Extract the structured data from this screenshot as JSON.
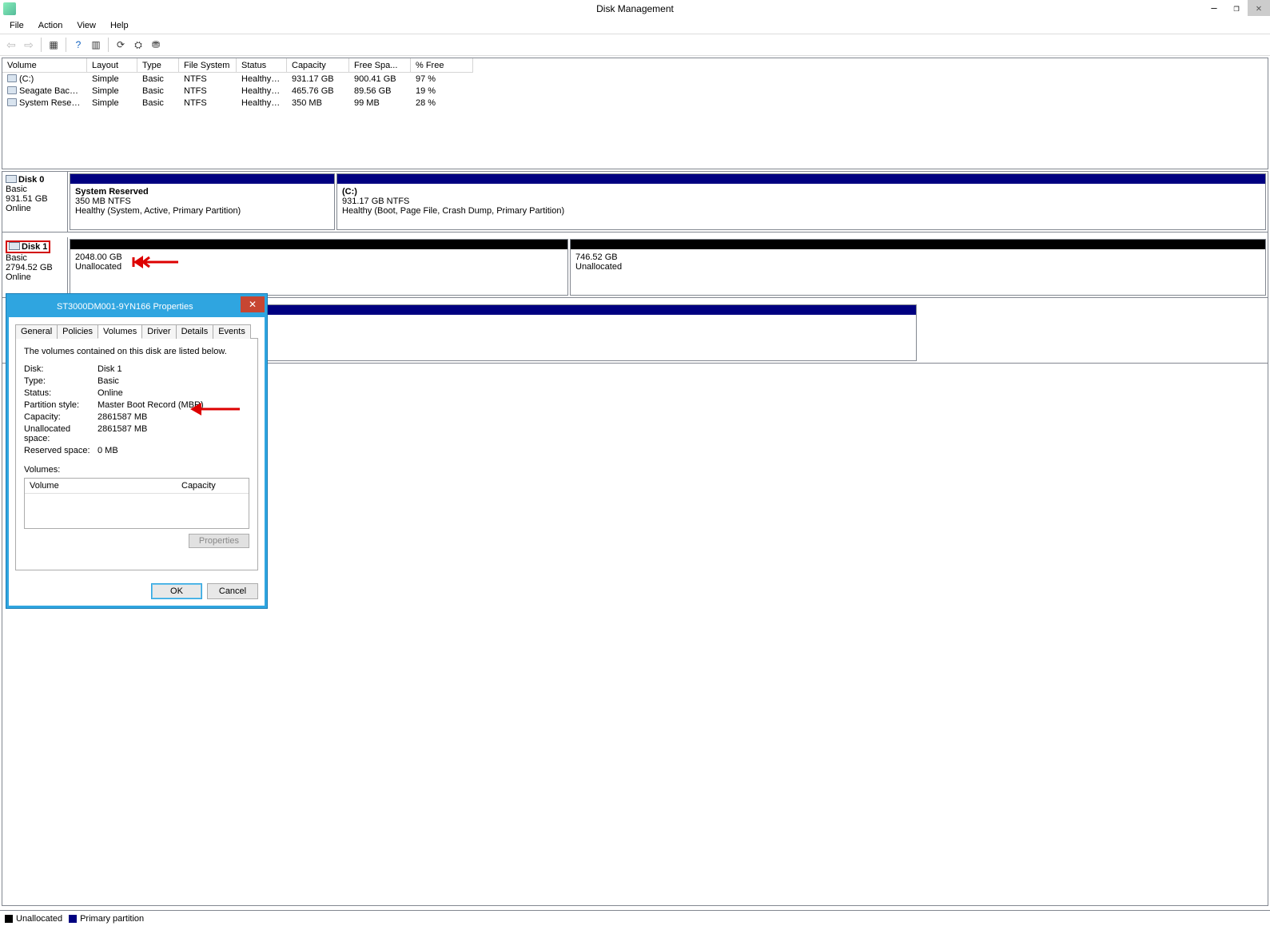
{
  "window": {
    "title": "Disk Management"
  },
  "menus": [
    "File",
    "Action",
    "View",
    "Help"
  ],
  "volume_table": {
    "headers": [
      "Volume",
      "Layout",
      "Type",
      "File System",
      "Status",
      "Capacity",
      "Free Spa...",
      "% Free"
    ],
    "rows": [
      {
        "volume": "(C:)",
        "layout": "Simple",
        "type": "Basic",
        "fs": "NTFS",
        "status": "Healthy (B...",
        "capacity": "931.17 GB",
        "free": "900.41 GB",
        "pct": "97 %"
      },
      {
        "volume": "Seagate Backup Pl...",
        "layout": "Simple",
        "type": "Basic",
        "fs": "NTFS",
        "status": "Healthy (P...",
        "capacity": "465.76 GB",
        "free": "89.56 GB",
        "pct": "19 %"
      },
      {
        "volume": "System Reserved",
        "layout": "Simple",
        "type": "Basic",
        "fs": "NTFS",
        "status": "Healthy (S...",
        "capacity": "350 MB",
        "free": "99 MB",
        "pct": "28 %"
      }
    ]
  },
  "disks": {
    "disk0": {
      "name": "Disk 0",
      "type": "Basic",
      "size": "931.51 GB",
      "status": "Online",
      "parts": [
        {
          "title": "System Reserved",
          "line2": "350 MB NTFS",
          "line3": "Healthy (System, Active, Primary Partition)"
        },
        {
          "title": "(C:)",
          "line2": "931.17 GB NTFS",
          "line3": "Healthy (Boot, Page File, Crash Dump, Primary Partition)"
        }
      ]
    },
    "disk1": {
      "name": "Disk 1",
      "type": "Basic",
      "size": "2794.52 GB",
      "status": "Online",
      "parts": [
        {
          "line1": "2048.00 GB",
          "line2": "Unallocated"
        },
        {
          "line1": "746.52 GB",
          "line2": "Unallocated"
        }
      ]
    }
  },
  "legend": {
    "unallocated": "Unallocated",
    "primary": "Primary partition"
  },
  "dialog": {
    "title": "ST3000DM001-9YN166 Properties",
    "tabs": [
      "General",
      "Policies",
      "Volumes",
      "Driver",
      "Details",
      "Events"
    ],
    "active_tab": "Volumes",
    "desc": "The volumes contained on this disk are listed below.",
    "kv": {
      "disk_k": "Disk:",
      "disk_v": "Disk 1",
      "type_k": "Type:",
      "type_v": "Basic",
      "status_k": "Status:",
      "status_v": "Online",
      "pstyle_k": "Partition style:",
      "pstyle_v": "Master Boot Record (MBR)",
      "cap_k": "Capacity:",
      "cap_v": "2861587 MB",
      "unalloc_k": "Unallocated space:",
      "unalloc_v": "2861587 MB",
      "res_k": "Reserved space:",
      "res_v": "0 MB"
    },
    "volbox_label": "Volumes:",
    "volbox_headers": {
      "volume": "Volume",
      "capacity": "Capacity"
    },
    "prop_btn": "Properties",
    "ok": "OK",
    "cancel": "Cancel"
  }
}
